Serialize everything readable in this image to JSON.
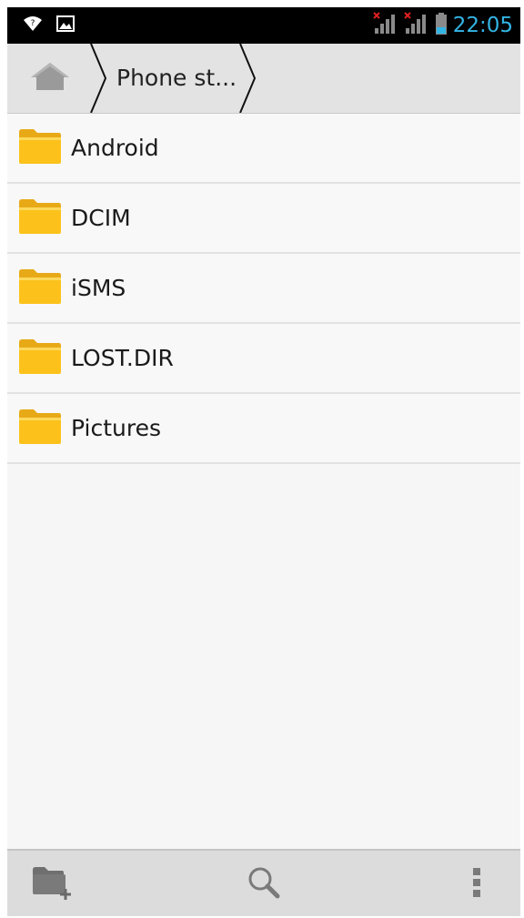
{
  "status_bar": {
    "time": "22:05",
    "icons": [
      "wifi-question-icon",
      "image-notification-icon",
      "signal-no-sim-1-icon",
      "signal-no-sim-2-icon",
      "battery-icon"
    ],
    "clock_color": "#33b5e5"
  },
  "breadcrumb": {
    "home_icon": "home-icon",
    "current": "Phone st..."
  },
  "folders": [
    {
      "name": "Android"
    },
    {
      "name": "DCIM"
    },
    {
      "name": "iSMS"
    },
    {
      "name": "LOST.DIR"
    },
    {
      "name": "Pictures"
    }
  ],
  "toolbar": {
    "icons": [
      "new-folder-icon",
      "search-icon",
      "overflow-menu-icon"
    ]
  },
  "colors": {
    "folder_fill": "#fcc21b",
    "folder_tab": "#e8a917",
    "accent": "#33b5e5"
  }
}
